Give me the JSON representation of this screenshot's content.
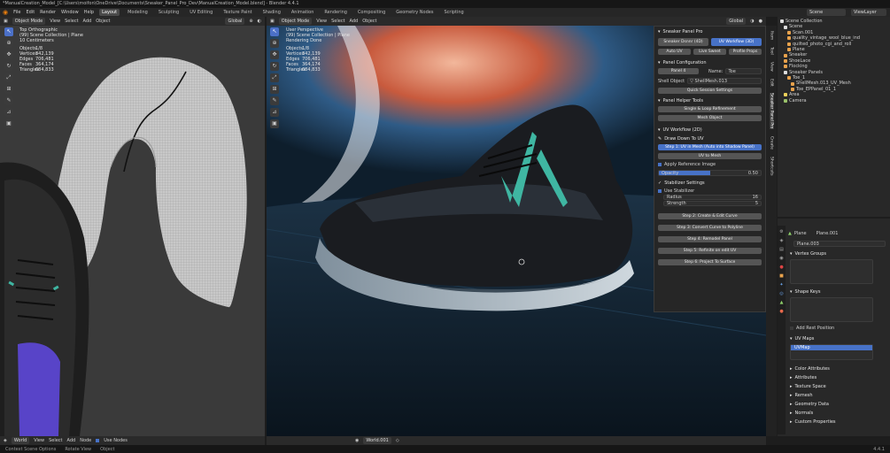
{
  "window_title": "*ManualCreation_Model_[C:\\Users\\moifon\\OneDrive\\Documents\\Sneaker_Panel_Pro_Dev\\ManualCreation_Model.blend] - Blender 4.4.1",
  "menu": [
    "File",
    "Edit",
    "Render",
    "Window",
    "Help"
  ],
  "workspaces": [
    "Layout",
    "Modeling",
    "Sculpting",
    "UV Editing",
    "Texture Paint",
    "Shading",
    "Animation",
    "Rendering",
    "Compositing",
    "Geometry Nodes",
    "Scripting"
  ],
  "active_workspace": "Layout",
  "scene_name": "Scene",
  "view_layer": "ViewLayer",
  "left_view": {
    "mode": "Object Mode",
    "menus": [
      "View",
      "Select",
      "Add",
      "Object"
    ],
    "orientation": "Global",
    "title": "Top Orthographic",
    "collection": "(99) Scene Collection | Plane",
    "units": "10 Centimeters",
    "stats": [
      {
        "k": "Objects",
        "v": "1/8"
      },
      {
        "k": "Vertices",
        "v": "342,139"
      },
      {
        "k": "Edges",
        "v": "706,481"
      },
      {
        "k": "Faces",
        "v": "364,174"
      },
      {
        "k": "Triangles",
        "v": "684,833"
      }
    ]
  },
  "right_view": {
    "mode": "Object Mode",
    "menus": [
      "View",
      "Select",
      "Add",
      "Object"
    ],
    "orientation": "Global",
    "title": "User Perspective",
    "collection": "(99) Scene Collection | Plane",
    "status": "Rendering Done",
    "stats": [
      {
        "k": "Objects",
        "v": "1/8"
      },
      {
        "k": "Vertices",
        "v": "342,139"
      },
      {
        "k": "Edges",
        "v": "706,481"
      },
      {
        "k": "Faces",
        "v": "364,174"
      },
      {
        "k": "Triangles",
        "v": "684,833"
      }
    ]
  },
  "npanel": {
    "title": "Sneaker Panel Pro",
    "tabs": [
      "Sneaker Dsnnr (4D)",
      "UV Workflow (3D)"
    ],
    "row2": [
      "Auto UV",
      "Live Sweet",
      "Profile Props"
    ],
    "panel_config_title": "Panel Configuration",
    "panel_label": "Panel 4",
    "name_label": "Name:",
    "name_value": "Toe",
    "shell_object_label": "Shell Object",
    "shell_object_value": "ShellMesh.013",
    "preset_btn": "Quick Session Settings",
    "helper_title": "Panel Helper Tools",
    "helper_btns": [
      "Single & Loop Refinement",
      "Mesh Object"
    ],
    "uv_title": "UV Workflow (2D)",
    "draw_title": "Draw Down To UV",
    "step1": "Step 1: UV in Mesh (Auto into Shadow Panel)",
    "uv_to_mesh": "UV to Mesh",
    "apply_ref": "Apply Reference Image",
    "opacity_label": "Opacity",
    "opacity_value": "0.50",
    "opacity_fraction": 0.5,
    "stabilizer_title": "Stabilizer Settings",
    "use_stabilizer": "Use Stabilizer",
    "radius_label": "Radius",
    "radius_value": "16",
    "strength_label": "Strength",
    "strength_value": "5",
    "steps": [
      "Step 2: Create & Edit Curve",
      "Step 3: Convert Curve to Polyline",
      "Step 4: Remodel Panel",
      "Step 5: Refinite on edit UV",
      "Step 6: Project To Surface"
    ]
  },
  "side_tabs": [
    "Item",
    "Tool",
    "View",
    "Edit",
    "Sneaker Panel Pro",
    "Create",
    "Shortcuts",
    "Realtime"
  ],
  "outliner": {
    "title": "Scene Collection",
    "items": [
      {
        "label": "Scene Collection",
        "depth": 0
      },
      {
        "label": "Scene",
        "depth": 1
      },
      {
        "label": "Scan.001",
        "depth": 2
      },
      {
        "label": "quality_vintage_wool_blue_ind",
        "depth": 2
      },
      {
        "label": "quilted_photo_cgi_and_roll",
        "depth": 2
      },
      {
        "label": "Plane",
        "depth": 2
      },
      {
        "label": "Sneaker",
        "depth": 1
      },
      {
        "label": "ShoeLace",
        "depth": 1
      },
      {
        "label": "Flocking",
        "depth": 1
      },
      {
        "label": "Sneaker Panels",
        "depth": 1
      },
      {
        "label": "Toe_1",
        "depth": 2
      },
      {
        "label": "ShellMesh.013_UV_Mesh",
        "depth": 3
      },
      {
        "label": "Toe_EPPanel_01_1",
        "depth": 3
      },
      {
        "label": "Area",
        "depth": 1
      },
      {
        "label": "Camera",
        "depth": 1
      }
    ]
  },
  "properties": {
    "object_label": "Plane",
    "object_sub": "Plane.001",
    "mesh_name": "Plane.003",
    "sections": [
      "Vertex Groups",
      "Shape Keys"
    ],
    "add_rest": "Add Rest Position",
    "uv_maps_title": "UV Maps",
    "uv_map_item": "UVMap",
    "more_sections": [
      "Color Attributes",
      "Attributes",
      "Texture Space",
      "Remesh",
      "Geometry Data",
      "Normals",
      "Custom Properties"
    ]
  },
  "left_footer": {
    "mode": "World",
    "menus": [
      "View",
      "Select",
      "Add",
      "Node"
    ],
    "use_nodes": "Use Nodes"
  },
  "right_footer": {
    "world": "World.001"
  },
  "status_bar": [
    "Context Scene Options",
    "Rotate View",
    "Object"
  ],
  "version": "4.4.1"
}
